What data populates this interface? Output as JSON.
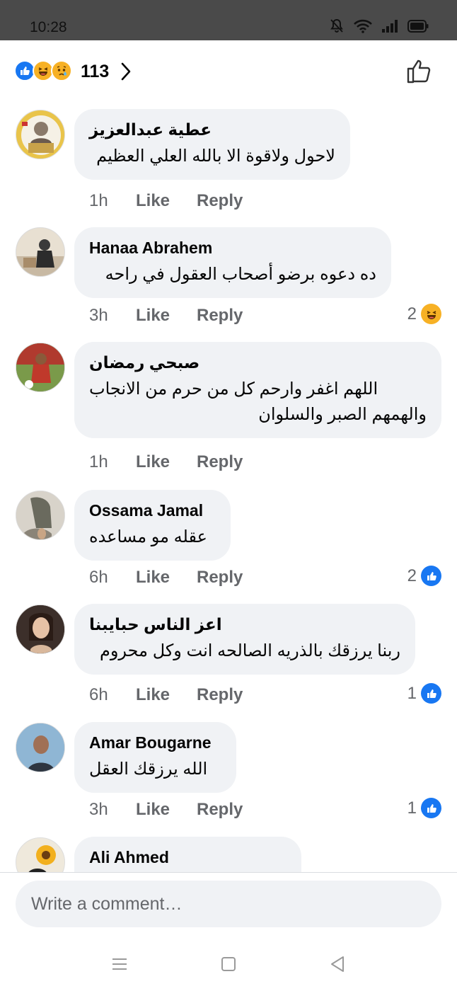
{
  "status_bar": {
    "time": "10:28",
    "icons": [
      "bell-off-icon",
      "wifi-icon",
      "signal-icon",
      "battery-icon"
    ]
  },
  "reactions_summary": {
    "icons": [
      "like-reaction-icon",
      "haha-reaction-icon",
      "sad-reaction-icon"
    ],
    "count": "113"
  },
  "comments": [
    {
      "author": "عطية عبدالعزيز",
      "text": [
        "لاحول ولاقوة الا بالله العلي العظيم"
      ],
      "time": "1h",
      "like_label": "Like",
      "reply_label": "Reply",
      "reaction_count": "",
      "reaction_icon": ""
    },
    {
      "author": "Hanaa Abrahem",
      "text": [
        "ده دعوه برضو  أصحاب العقول في راحه"
      ],
      "time": "3h",
      "like_label": "Like",
      "reply_label": "Reply",
      "reaction_count": "2",
      "reaction_icon": "haha-reaction-icon"
    },
    {
      "author": "صبحي رمضان",
      "text": [
        "اللهم اغفر وارحم كل من حرم من الانجاب",
        "والهمهم الصبر والسلوان"
      ],
      "time": "1h",
      "like_label": "Like",
      "reply_label": "Reply",
      "reaction_count": "",
      "reaction_icon": ""
    },
    {
      "author": "Ossama Jamal",
      "text": [
        "عقله مو مساعده"
      ],
      "time": "6h",
      "like_label": "Like",
      "reply_label": "Reply",
      "reaction_count": "2",
      "reaction_icon": "like-reaction-icon"
    },
    {
      "author": "اعز الناس حبايبنا",
      "text": [
        "ربنا يرزقك بالذريه الصالحه انت وكل محروم"
      ],
      "time": "6h",
      "like_label": "Like",
      "reply_label": "Reply",
      "reaction_count": "1",
      "reaction_icon": "like-reaction-icon"
    },
    {
      "author": "Amar Bougarne",
      "text": [
        "الله يرزقك العقل"
      ],
      "time": "3h",
      "like_label": "Like",
      "reply_label": "Reply",
      "reaction_count": "1",
      "reaction_icon": "like-reaction-icon"
    },
    {
      "author": "Ali Ahmed",
      "text": [],
      "time": "",
      "like_label": "",
      "reply_label": "",
      "reaction_count": "",
      "reaction_icon": ""
    }
  ],
  "composer": {
    "placeholder": "Write a comment…"
  },
  "nav_bar": {
    "icons": [
      "menu-icon",
      "home-square-icon",
      "back-triangle-icon"
    ]
  },
  "colors": {
    "like_blue": "#1877f2",
    "haha_yellow": "#f7b125",
    "bubble_bg": "#f0f2f5",
    "meta_gray": "#65676b"
  }
}
